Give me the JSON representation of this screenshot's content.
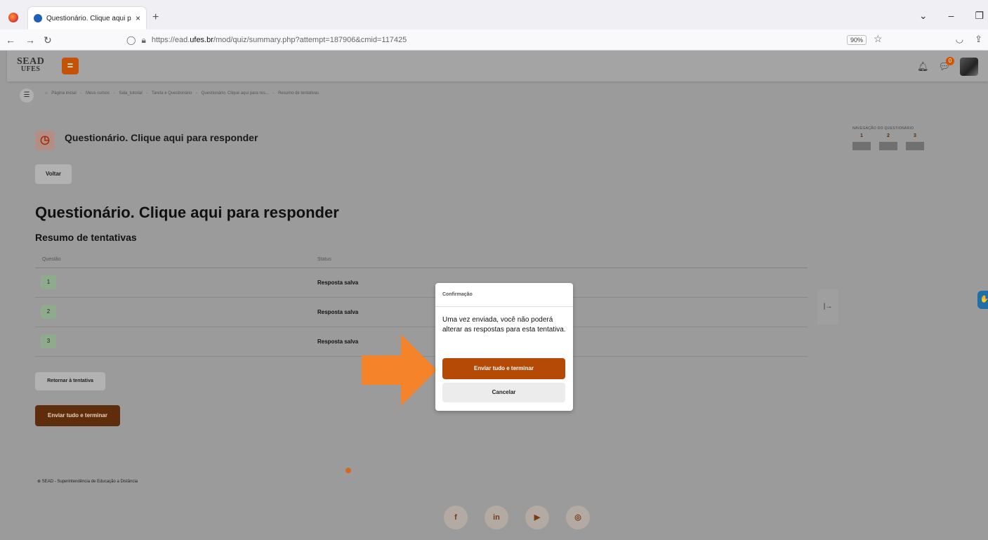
{
  "browser": {
    "tab_title": "Questionário. Clique aqui para",
    "tab_close": "×",
    "new_tab": "+",
    "url_prefix": "https://ead.",
    "url_host": "ufes.br",
    "url_path": "/mod/quiz/summary.php?attempt=187906&cmid=117425",
    "zoom": "90%"
  },
  "site": {
    "logo_line1": "SEAD",
    "logo_line2": "UFES",
    "menu_label": "=",
    "chat_badge": "0"
  },
  "breadcrumb": [
    "Página inicial",
    "Meus cursos",
    "Sala_tutorial",
    "Tarefa e Questionário",
    "Questionário. Clique aqui para res...",
    "Resumo de tentativas"
  ],
  "breadcrumb_sep": "-",
  "header": {
    "quiz_title": "Questionário. Clique aqui para responder",
    "back_button": "Voltar"
  },
  "main": {
    "title": "Questionário. Clique aqui para responder",
    "subtitle": "Resumo de tentativas",
    "col_question": "Questão",
    "col_status": "Status",
    "rows": [
      {
        "num": "1",
        "status": "Resposta salva"
      },
      {
        "num": "2",
        "status": "Resposta salva"
      },
      {
        "num": "3",
        "status": "Resposta salva"
      }
    ],
    "return_button": "Retornar à tentativa",
    "submit_button": "Enviar tudo e terminar"
  },
  "quiz_nav": {
    "title": "NAVEGAÇÃO DO QUESTIONÁRIO",
    "items": [
      "1",
      "2",
      "3"
    ]
  },
  "footer": {
    "text": "SEAD - Superintendência de Educação a Distância"
  },
  "dialog": {
    "title": "Confirmação",
    "body": "Uma vez enviada, você não poderá alterar as respostas para esta tentativa.",
    "submit": "Enviar tudo e terminar",
    "cancel": "Cancelar"
  },
  "colors": {
    "accent": "#b44a05",
    "arrow": "#f5832a",
    "overlay": "#9b9b9b"
  }
}
